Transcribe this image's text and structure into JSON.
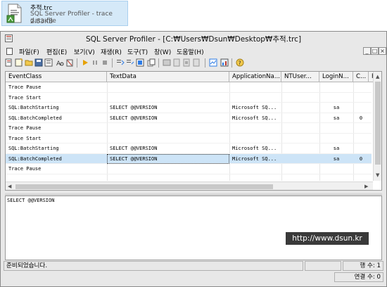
{
  "file": {
    "name": "추적.trc",
    "type": "SQL Server Profiler - trace data file",
    "size": "2.53KB"
  },
  "window": {
    "title": "SQL Server Profiler - [C:₩Users₩Dsun₩Desktop₩추적.trc]"
  },
  "menu": [
    "파일(F)",
    "편집(E)",
    "보기(V)",
    "재생(R)",
    "도구(T)",
    "창(W)",
    "도움말(H)"
  ],
  "mdi_buttons": [
    "_",
    "□",
    "×"
  ],
  "columns": [
    "EventClass",
    "TextData",
    "ApplicationNa...",
    "NTUser...",
    "LoginN...",
    "C...",
    "R"
  ],
  "rows": [
    {
      "event": "Trace Pause",
      "text": "",
      "app": "",
      "ntuser": "",
      "login": "",
      "c": ""
    },
    {
      "event": "Trace Start",
      "text": "",
      "app": "",
      "ntuser": "",
      "login": "",
      "c": ""
    },
    {
      "event": "SQL:BatchStarting",
      "text": "SELECT @@VERSION",
      "app": "Microsoft SQ...",
      "ntuser": "",
      "login": "sa",
      "c": ""
    },
    {
      "event": "SQL:BatchCompleted",
      "text": "SELECT @@VERSION",
      "app": "Microsoft SQ...",
      "ntuser": "",
      "login": "sa",
      "c": "0"
    },
    {
      "event": "Trace Pause",
      "text": "",
      "app": "",
      "ntuser": "",
      "login": "",
      "c": ""
    },
    {
      "event": "Trace Start",
      "text": "",
      "app": "",
      "ntuser": "",
      "login": "",
      "c": ""
    },
    {
      "event": "SQL:BatchStarting",
      "text": "SELECT @@VERSION",
      "app": "Microsoft SQ...",
      "ntuser": "",
      "login": "sa",
      "c": ""
    },
    {
      "event": "SQL:BatchCompleted",
      "text": "SELECT @@VERSION",
      "app": "Microsoft SQ...",
      "ntuser": "",
      "login": "sa",
      "c": "0"
    },
    {
      "event": "Trace Pause",
      "text": "",
      "app": "",
      "ntuser": "",
      "login": "",
      "c": ""
    }
  ],
  "selected_row": 7,
  "text_pane": "SELECT @@VERSION",
  "watermark": "http://www.dsun.kr",
  "status": {
    "ready": "준비되었습니다.",
    "row_count": "행 수: 1",
    "connections": "연결 수: 0"
  },
  "colors": {
    "selection": "#cde4f7",
    "tile": "#d5e9f8"
  }
}
